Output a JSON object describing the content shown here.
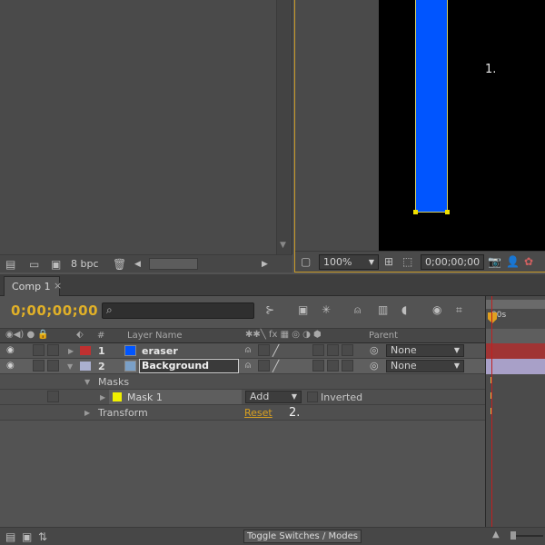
{
  "project": {
    "bpc": "8 bpc"
  },
  "viewer": {
    "annotation_1": "1.",
    "zoom": "100%",
    "timecode": "0;00;00;00",
    "layer_color": "#0055ff"
  },
  "timeline": {
    "tab_label": "Comp 1",
    "tab_close": "×",
    "timecode": "0;00;00;00",
    "search_placeholder": "",
    "ruler_label": "00s",
    "columns": {
      "number": "#",
      "layer_name": "Layer Name",
      "parent": "Parent"
    },
    "layers": [
      {
        "number": "1",
        "name": "eraser",
        "color": "#c03030",
        "parent": "None"
      },
      {
        "number": "2",
        "name": "Background",
        "color": "#aab0d0",
        "parent": "None"
      }
    ],
    "masks_label": "Masks",
    "mask": {
      "name": "Mask 1",
      "color": "#f0f000",
      "mode": "Add",
      "inverted_label": "Inverted"
    },
    "transform_label": "Transform",
    "reset_label": "Reset",
    "annotation_2": "2.",
    "toggle_label": "Toggle Switches / Modes"
  }
}
